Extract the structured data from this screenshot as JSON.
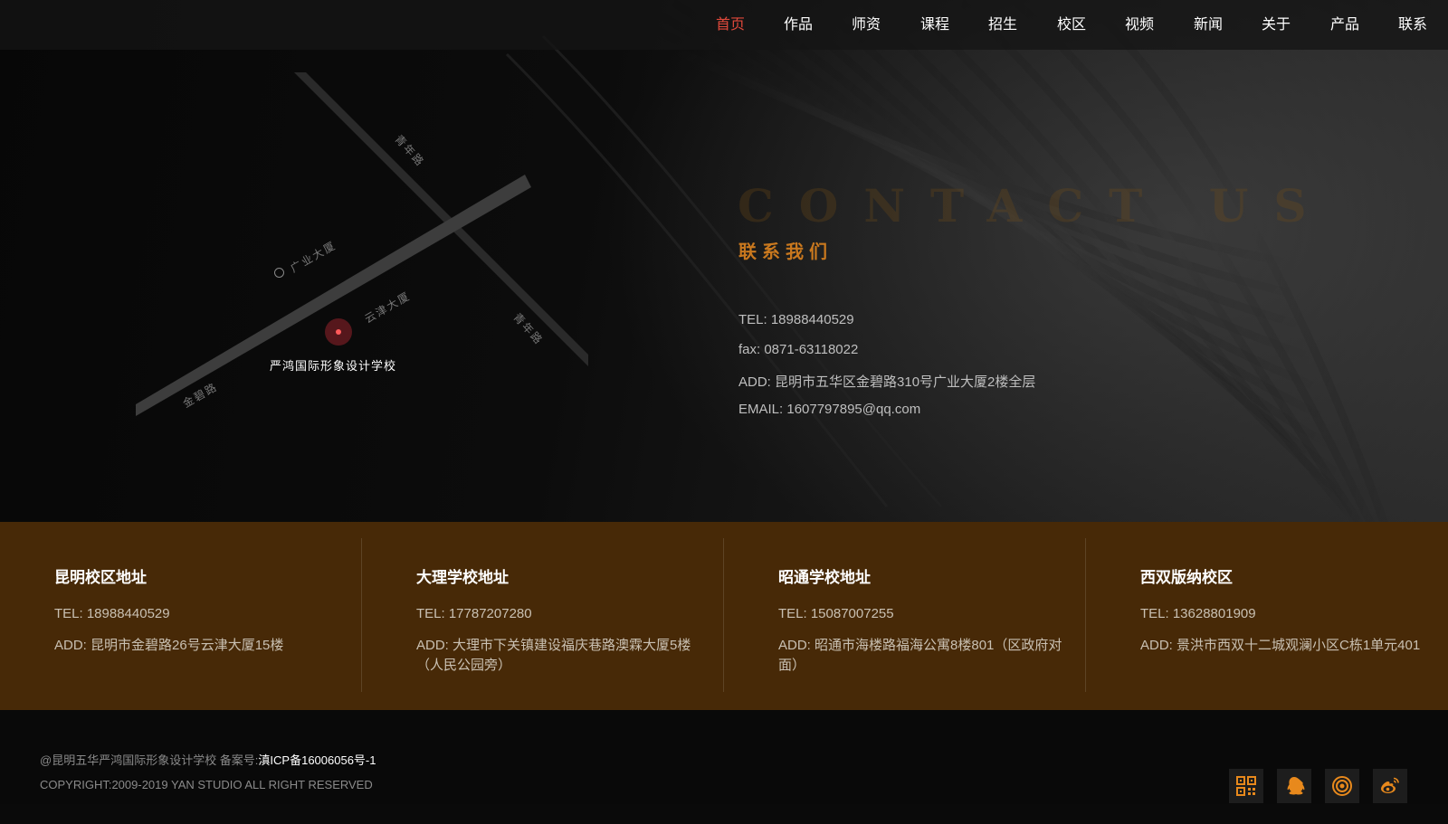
{
  "nav": {
    "items": [
      {
        "label": "首页",
        "active": true
      },
      {
        "label": "作品"
      },
      {
        "label": "师资"
      },
      {
        "label": "课程"
      },
      {
        "label": "招生"
      },
      {
        "label": "校区"
      },
      {
        "label": "视频"
      },
      {
        "label": "新闻"
      },
      {
        "label": "关于"
      },
      {
        "label": "产品"
      },
      {
        "label": "联系"
      }
    ]
  },
  "map": {
    "school_name": "严鸿国际形象设计学校",
    "labels": {
      "road_top": "青年路",
      "guangye": "广业大厦",
      "yunjin": "云津大厦",
      "road_right": "青年路",
      "jinbi": "金碧路"
    }
  },
  "contact": {
    "title_en": "CONTACT US",
    "title_cn": "联系我们",
    "tel": "TEL: 18988440529",
    "fax": "fax: 0871-63118022",
    "add": "ADD: 昆明市五华区金碧路310号广业大厦2楼全层",
    "email": "EMAIL: 1607797895@qq.com"
  },
  "campuses": [
    {
      "title": "昆明校区地址",
      "tel": "TEL: 18988440529",
      "add": "ADD: 昆明市金碧路26号云津大厦15楼"
    },
    {
      "title": "大理学校地址",
      "tel": "TEL: 17787207280",
      "add": "ADD: 大理市下关镇建设福庆巷路澳霖大厦5楼（人民公园旁）"
    },
    {
      "title": "昭通学校地址",
      "tel": "TEL: 15087007255",
      "add": "ADD: 昭通市海楼路福海公寓8楼801（区政府对面）"
    },
    {
      "title": "西双版纳校区",
      "tel": "TEL: 13628801909",
      "add": "ADD: 景洪市西双十二城观澜小区C栋1单元401"
    }
  ],
  "footer": {
    "line1_prefix": "@昆明五华严鸿国际形象设计学校 备案号:",
    "icp": "滇ICP备16006056号-1",
    "line2": "COPYRIGHT:2009-2019 YAN STUDIO ALL RIGHT RESERVED"
  },
  "social": [
    {
      "icon": "qrcode-icon"
    },
    {
      "icon": "qq-icon"
    },
    {
      "icon": "target-icon"
    },
    {
      "icon": "weibo-icon"
    }
  ],
  "colors": {
    "accent": "#c9781e",
    "active_nav": "#e0493b",
    "campus_band": "#472907",
    "social_icon": "#e8891c"
  }
}
